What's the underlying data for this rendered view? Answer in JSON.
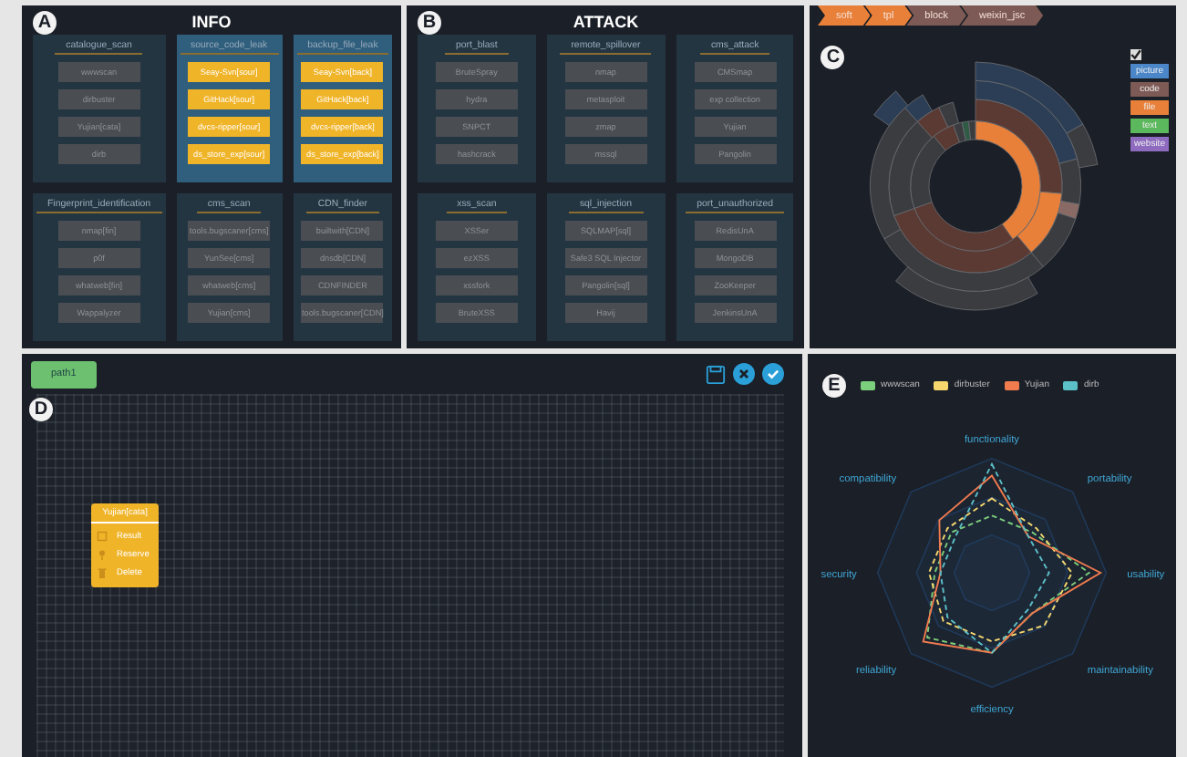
{
  "info_panel": {
    "badge": "A",
    "title": "INFO",
    "groups": [
      {
        "title": "catalogue_scan",
        "selected": false,
        "tools": [
          "wwwscan",
          "dirbuster",
          "Yujian[cata]",
          "dirb"
        ]
      },
      {
        "title": "source_code_leak",
        "selected": true,
        "tools": [
          "Seay-Svn[sour]",
          "GitHack[sour]",
          "dvcs-ripper[sour]",
          "ds_store_exp[sour]"
        ]
      },
      {
        "title": "backup_file_leak",
        "selected": true,
        "tools": [
          "Seay-Svn[back]",
          "GitHack[back]",
          "dvcs-ripper[back]",
          "ds_store_exp[back]"
        ]
      },
      {
        "title": "Fingerprint_identification",
        "selected": false,
        "tools": [
          "nmap[fin]",
          "p0f",
          "whatweb[fin]",
          "Wappalyzer"
        ]
      },
      {
        "title": "cms_scan",
        "selected": false,
        "tools": [
          "tools.bugscaner[cms]",
          "YunSee[cms]",
          "whatweb[cms]",
          "Yujian[cms]"
        ]
      },
      {
        "title": "CDN_finder",
        "selected": false,
        "tools": [
          "builtwith[CDN]",
          "dnsdb[CDN]",
          "CDNFINDER",
          "tools.bugscaner[CDN]"
        ]
      }
    ]
  },
  "attack_panel": {
    "badge": "B",
    "title": "ATTACK",
    "groups": [
      {
        "title": "port_blast",
        "selected": false,
        "tools": [
          "BruteSpray",
          "hydra",
          "SNPCT",
          "hashcrack"
        ]
      },
      {
        "title": "remote_spillover",
        "selected": false,
        "tools": [
          "nmap",
          "metasploit",
          "zmap",
          "mssql"
        ]
      },
      {
        "title": "cms_attack",
        "selected": false,
        "tools": [
          "CMSmap",
          "exp collection",
          "Yujian",
          "Pangolin"
        ]
      },
      {
        "title": "xss_scan",
        "selected": false,
        "tools": [
          "XSSer",
          "ezXSS",
          "xssfork",
          "BruteXSS"
        ]
      },
      {
        "title": "sql_injection",
        "selected": false,
        "tools": [
          "SQLMAP[sql]",
          "Safe3 SQL Injector",
          "Pangolin[sql]",
          "Havij"
        ]
      },
      {
        "title": "port_unauthorized",
        "selected": false,
        "tools": [
          "RedisUnA",
          "MongoDB",
          "ZooKeeper",
          "JenkinsUnA"
        ]
      }
    ]
  },
  "sunburst_panel": {
    "badge": "C",
    "breadcrumb": [
      {
        "label": "soft",
        "color": "#e8803a"
      },
      {
        "label": "tpl",
        "color": "#e8803a"
      },
      {
        "label": "block",
        "color": "#7d5a55"
      },
      {
        "label": "weixin_jsc",
        "color": "#7d5a55"
      }
    ],
    "legend_checkbox": {
      "checked": true
    },
    "legend": [
      {
        "label": "picture",
        "color": "#4a86c8"
      },
      {
        "label": "code",
        "color": "#7d5a55"
      },
      {
        "label": "file",
        "color": "#e8803a"
      },
      {
        "label": "text",
        "color": "#5cb85c"
      },
      {
        "label": "website",
        "color": "#8e6bbf"
      }
    ]
  },
  "workflow_panel": {
    "badge": "D",
    "tabs": [
      {
        "label": "path1",
        "selected": true
      }
    ],
    "node": {
      "title": "Yujian[cata]",
      "actions": [
        "Result",
        "Reserve",
        "Delete"
      ]
    }
  },
  "radar_panel": {
    "badge": "E",
    "legend": [
      {
        "name": "wwwscan",
        "color": "#7ccf7c"
      },
      {
        "name": "dirbuster",
        "color": "#f5d76e"
      },
      {
        "name": "Yujian",
        "color": "#f07b4f"
      },
      {
        "name": "dirb",
        "color": "#5bc0c8"
      }
    ],
    "axes": [
      "functionality",
      "portability",
      "usability",
      "maintainability",
      "efficiency",
      "reliability",
      "security",
      "compatibility"
    ]
  }
}
